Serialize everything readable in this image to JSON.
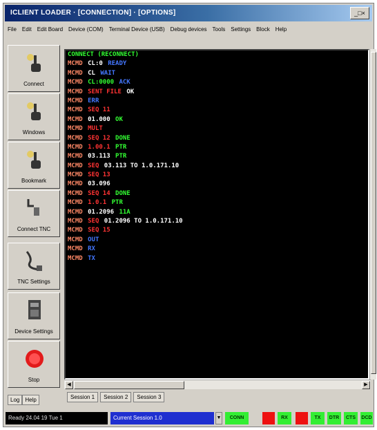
{
  "window": {
    "title": "ICLIENT LOADER · [CONNECTION] · [OPTIONS]",
    "buttons_label": "_□×"
  },
  "menu": [
    "File",
    "Edit",
    "Edit Board",
    "Device (COM)",
    "Terminal Device (USB)",
    "Debug devices",
    "Tools",
    "Settings",
    "Block",
    "Help"
  ],
  "sidebar": [
    {
      "label": "Connect",
      "icon": "hand-pointer-icon"
    },
    {
      "label": "Windows",
      "icon": "hand-pointer-icon"
    },
    {
      "label": "Bookmark",
      "icon": "hand-pointer-icon"
    },
    {
      "label": "Connect TNC",
      "icon": "tnc-connector-icon"
    },
    {
      "label": "TNC Settings",
      "icon": "cable-icon"
    },
    {
      "label": "Device Settings",
      "icon": "device-board-icon"
    },
    {
      "label": "Stop",
      "icon": "stop-icon"
    }
  ],
  "sidebar_tabs": [
    "Log",
    "Help"
  ],
  "terminal": {
    "lines": [
      [
        {
          "t": "CONNECT (RECONNECT)",
          "c": "#33ff33"
        }
      ],
      [
        {
          "t": "MCMD",
          "c": "#ff8866"
        },
        {
          "t": "CL:0",
          "c": "#ffffff"
        },
        {
          "t": "READY",
          "c": "#4477ff"
        }
      ],
      [
        {
          "t": "MCMD",
          "c": "#ff8866"
        },
        {
          "t": "CL",
          "c": "#ffffff"
        },
        {
          "t": "WAIT",
          "c": "#4477ff"
        }
      ],
      [
        {
          "t": "MCMD",
          "c": "#ff8866"
        },
        {
          "t": "CL:0000",
          "c": "#33ff33"
        },
        {
          "t": "ACK",
          "c": "#4477ff"
        }
      ],
      [
        {
          "t": "MCMD",
          "c": "#ff8866"
        },
        {
          "t": "SENT FILE",
          "c": "#ff3333"
        },
        {
          "t": "OK",
          "c": "#ffffff"
        }
      ],
      [
        {
          "t": "MCMD",
          "c": "#ff8866"
        },
        {
          "t": "ERR",
          "c": "#4477ff"
        }
      ],
      [
        {
          "t": "MCMD",
          "c": "#ff8866"
        },
        {
          "t": "SEQ 11",
          "c": "#ff3333"
        }
      ],
      [
        {
          "t": "MCMD",
          "c": "#ff8866"
        },
        {
          "t": "01.000",
          "c": "#ffffff"
        },
        {
          "t": "OK",
          "c": "#33ff33"
        }
      ],
      [
        {
          "t": "MCMD",
          "c": "#ff8866"
        },
        {
          "t": "MULT",
          "c": "#ff3333"
        }
      ],
      [
        {
          "t": "MCMD",
          "c": "#ff8866"
        },
        {
          "t": "SEQ 12",
          "c": "#ff3333"
        },
        {
          "t": "DONE",
          "c": "#33ff33"
        }
      ],
      [
        {
          "t": "MCMD",
          "c": "#ff8866"
        },
        {
          "t": "1.00.1",
          "c": "#ff3333"
        },
        {
          "t": "PTR",
          "c": "#33ff33"
        }
      ],
      [
        {
          "t": "MCMD",
          "c": "#ff8866"
        },
        {
          "t": "03.113",
          "c": "#ffffff"
        },
        {
          "t": "PTR",
          "c": "#33ff33"
        }
      ],
      [
        {
          "t": "MCMD",
          "c": "#ff8866"
        },
        {
          "t": "SEQ",
          "c": "#ff3333"
        },
        {
          "t": "03.113 TO 1.0.171.10",
          "c": "#ffffff"
        }
      ],
      [
        {
          "t": "MCMD",
          "c": "#ff8866"
        },
        {
          "t": "SEQ 13",
          "c": "#ff3333"
        }
      ],
      [
        {
          "t": "MCMD",
          "c": "#ff8866"
        },
        {
          "t": "03.096",
          "c": "#ffffff"
        }
      ],
      [
        {
          "t": "MCMD",
          "c": "#ff8866"
        },
        {
          "t": "SEQ 14",
          "c": "#ff3333"
        },
        {
          "t": "DONE",
          "c": "#33ff33"
        }
      ],
      [
        {
          "t": "MCMD",
          "c": "#ff8866"
        },
        {
          "t": "1.0.1",
          "c": "#ff3333"
        },
        {
          "t": "PTR",
          "c": "#33ff33"
        }
      ],
      [
        {
          "t": "MCMD",
          "c": "#ff8866"
        },
        {
          "t": "01.2096",
          "c": "#ffffff"
        },
        {
          "t": "11A",
          "c": "#33ff33"
        }
      ],
      [
        {
          "t": "MCMD",
          "c": "#ff8866"
        },
        {
          "t": "SEQ",
          "c": "#ff3333"
        },
        {
          "t": "01.2096 TO 1.0.171.10",
          "c": "#ffffff"
        }
      ],
      [
        {
          "t": "MCMD",
          "c": "#ff8866"
        },
        {
          "t": "SEQ 15",
          "c": "#ff3333"
        }
      ],
      [
        {
          "t": "MCMD",
          "c": "#ff8866"
        },
        {
          "t": "OUT",
          "c": "#4477ff"
        }
      ],
      [
        {
          "t": "MCMD",
          "c": "#ff8866"
        },
        {
          "t": "RX",
          "c": "#4477ff"
        }
      ],
      [
        {
          "t": "MCMD",
          "c": "#ff8866"
        },
        {
          "t": "TX",
          "c": "#4477ff"
        }
      ]
    ]
  },
  "session_tabs": [
    "Session 1",
    "Session 2",
    "Session 3"
  ],
  "status": {
    "left": "Ready 24.04 19 Tue 1",
    "mid": "Current Session 1.0",
    "leds": [
      {
        "label": "CONN",
        "color": "#33ee33"
      },
      {
        "label": "",
        "color": "#ee1111"
      },
      {
        "label": "RX",
        "color": "#33ee33"
      },
      {
        "label": "",
        "color": "#ee1111"
      },
      {
        "label": "TX",
        "color": "#33ee33"
      },
      {
        "label": "DTR",
        "color": "#33ee33"
      },
      {
        "label": "CTS",
        "color": "#33ee33"
      },
      {
        "label": "DCD",
        "color": "#33ee33"
      }
    ]
  }
}
